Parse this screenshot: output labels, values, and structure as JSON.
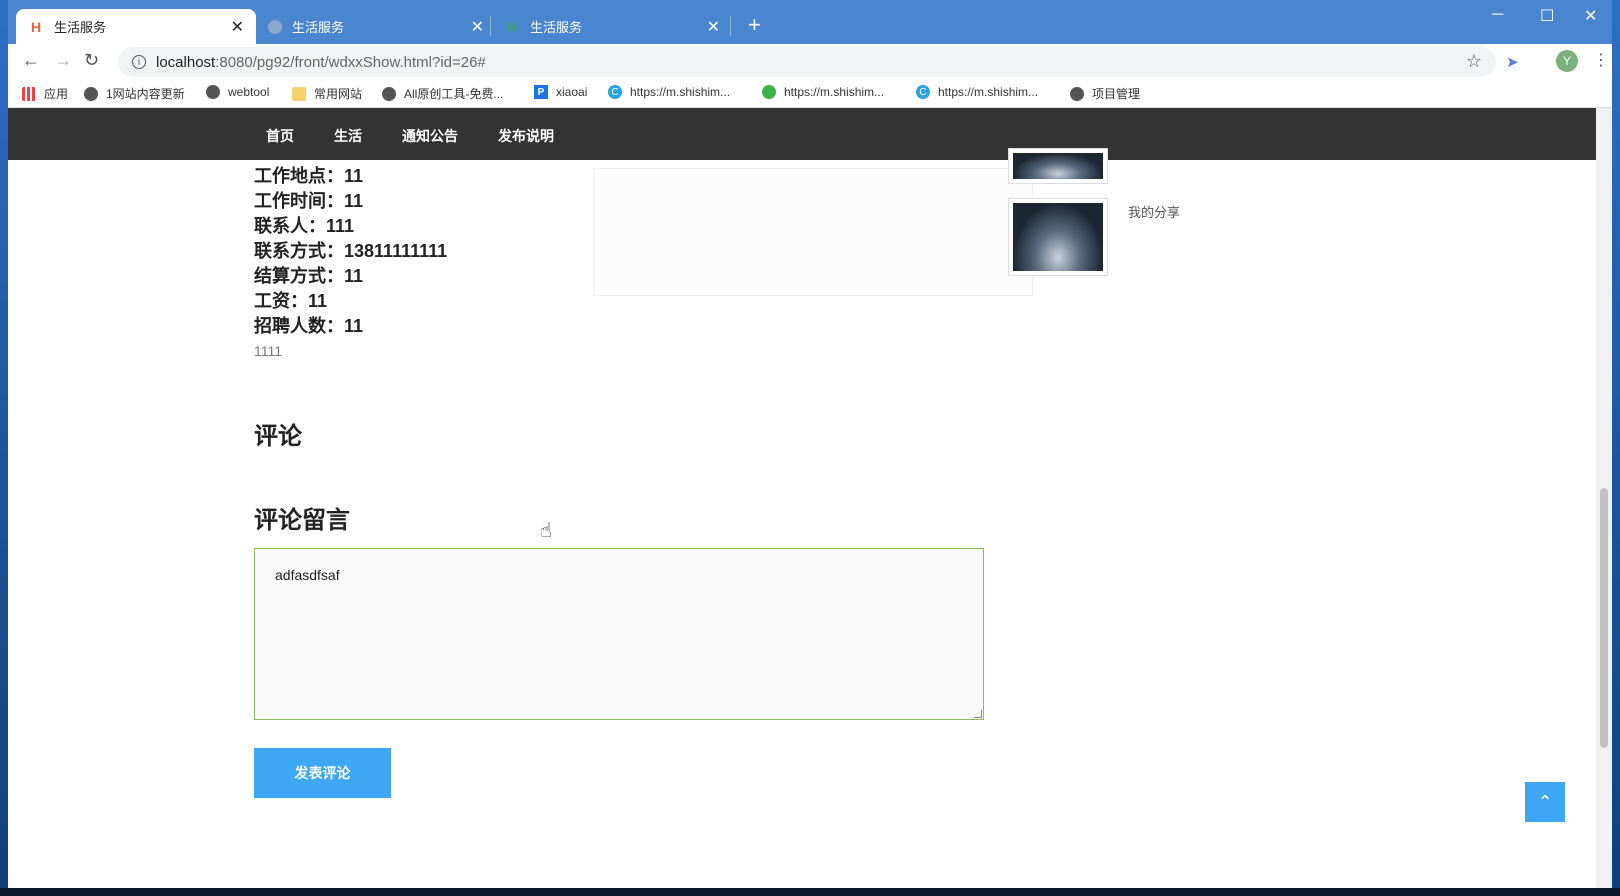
{
  "browser": {
    "tabs": [
      {
        "title": "生活服务",
        "active": true
      },
      {
        "title": "生活服务",
        "active": false
      },
      {
        "title": "生活服务",
        "active": false
      }
    ],
    "new_tab": "+",
    "url_host": "localhost",
    "url_path": ":8080/pg92/front/wdxxShow.html?id=26#",
    "window_controls": {
      "minimize": "─",
      "maximize": "☐",
      "close": "✕"
    },
    "profile_initial": "Y",
    "bookmarks": [
      {
        "label": "应用",
        "icon": "apps-grid-icon"
      },
      {
        "label": "1网站内容更新",
        "icon": "globe-icon"
      },
      {
        "label": "webtool",
        "icon": "globe-icon"
      },
      {
        "label": "常用网站",
        "icon": "folder-icon"
      },
      {
        "label": "All原创工具-免费...",
        "icon": "globe-icon"
      },
      {
        "label": "xiaoai",
        "icon": "p-icon"
      },
      {
        "label": "https://m.shishim...",
        "icon": "c-icon"
      },
      {
        "label": "https://m.shishim...",
        "icon": "wechat-icon"
      },
      {
        "label": "https://m.shishim...",
        "icon": "c-icon"
      },
      {
        "label": "项目管理",
        "icon": "globe-icon"
      }
    ]
  },
  "site": {
    "nav": [
      "首页",
      "生活",
      "通知公告",
      "发布说明"
    ],
    "details": [
      "工作地点：11",
      "工作时间：11",
      "联系人：111",
      "联系方式：13811111111",
      "结算方式：11",
      "工资：11",
      "招聘人数：11"
    ],
    "body_text": "1111",
    "comments_heading": "评论",
    "reply_heading": "评论留言",
    "comment_value": "adfasdfsaf",
    "submit_label": "发表评论",
    "back_to_top": "⌃",
    "sidebar": {
      "share_label": "我的分享"
    }
  },
  "colors": {
    "tab_bar": "#4a86d0",
    "site_nav": "#333333",
    "accent_button": "#3ea7f5",
    "textarea_border": "#8bbd5b"
  }
}
